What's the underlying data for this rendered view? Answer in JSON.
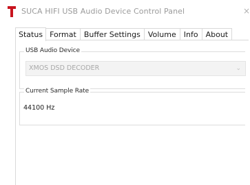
{
  "window": {
    "title": "SUCA HIFI USB Audio Device Control Panel",
    "logo_color": "#c8141e",
    "close_glyph": "×"
  },
  "tabs": [
    {
      "label": "Status",
      "active": true
    },
    {
      "label": "Format",
      "active": false
    },
    {
      "label": "Buffer Settings",
      "active": false
    },
    {
      "label": "Volume",
      "active": false
    },
    {
      "label": "Info",
      "active": false
    },
    {
      "label": "About",
      "active": false
    }
  ],
  "status": {
    "usb_device": {
      "group_label": "USB Audio Device",
      "selected_value": "XMOS DSD DECODER",
      "chevron_icon": "chevron-down-icon"
    },
    "sample_rate": {
      "group_label": "Current Sample Rate",
      "value": "44100 Hz"
    }
  }
}
